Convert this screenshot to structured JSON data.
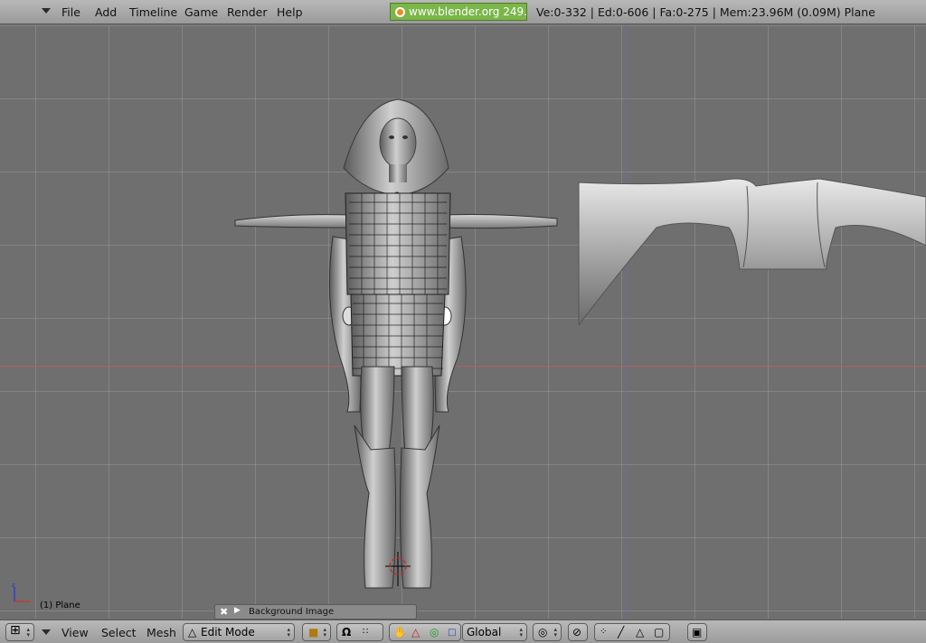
{
  "top_header": {
    "menus": [
      "File",
      "Add",
      "Timeline",
      "Game",
      "Render",
      "Help"
    ],
    "blender_badge": "www.blender.org 249.2",
    "stats": "Ve:0-332 | Ed:0-606 | Fa:0-275 | Mem:23.96M (0.09M) Plane"
  },
  "viewport": {
    "object_label": "(1) Plane",
    "background_image_panel": {
      "label": "Background Image"
    }
  },
  "bottom_header": {
    "menus": [
      "View",
      "Select",
      "Mesh"
    ],
    "mode_select": "Edit Mode",
    "orientation_select": "Global",
    "icons": {
      "editor_type": "crosshair-grid-icon",
      "mode": "vertex-triangle-icon",
      "draw_type": "solid-cube-icon",
      "pivot": "magnet-icon",
      "manipulator_hand": "hand-icon",
      "translate": "red-triangle-icon",
      "rotate": "green-circle-icon",
      "scale": "blue-square-icon",
      "snap": "target-icon",
      "proportional": "stripes-icon",
      "select_vertex": "vertex-dots-icon",
      "select_edge": "edge-line-icon",
      "select_face": "face-triangle-icon",
      "occlude": "cube-outline-icon",
      "render_preview": "picture-icon"
    }
  },
  "colors": {
    "badge_green": "#7ab648",
    "viewport_bg": "#6f6f6f",
    "axis_x": "#b06060",
    "axis_z": "#6a6ab0"
  }
}
